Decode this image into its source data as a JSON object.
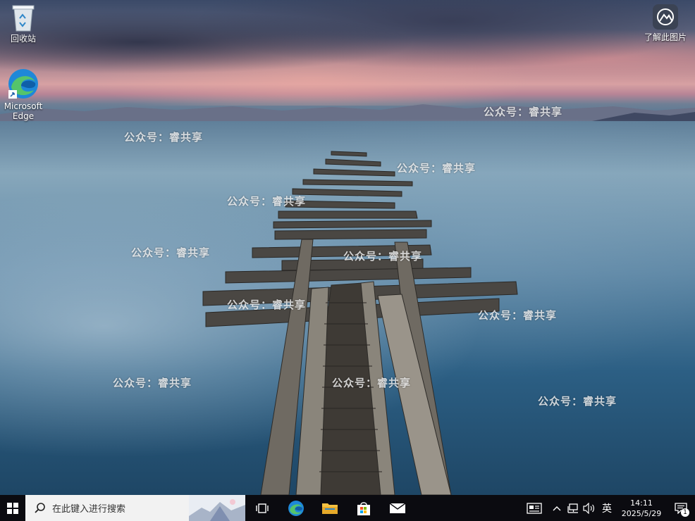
{
  "desktop": {
    "icons": [
      {
        "label": "回收站",
        "icon": "recycle-bin-icon"
      },
      {
        "label": "Microsoft\nEdge",
        "icon": "edge-icon"
      },
      {
        "label": "了解此图片",
        "icon": "learn-about-picture-icon"
      }
    ],
    "watermark_text": "公众号：睿共享"
  },
  "taskbar": {
    "start_icon": "windows-logo-icon",
    "search_placeholder": "在此键入进行搜索",
    "pinned": [
      {
        "name": "task-view",
        "icon": "task-view-icon"
      },
      {
        "name": "edge",
        "icon": "edge-icon"
      },
      {
        "name": "file-explorer",
        "icon": "folder-icon"
      },
      {
        "name": "microsoft-store",
        "icon": "store-icon"
      },
      {
        "name": "mail",
        "icon": "mail-icon"
      }
    ],
    "tray": {
      "ime_label": "英",
      "time": "14:11",
      "date": "2025/5/29",
      "notification_count": "1"
    }
  },
  "colors": {
    "taskbar_bg": "#0b0b10",
    "search_bg": "#f2f2f2",
    "edge_blue": "#1e88d8",
    "edge_green": "#55c46b",
    "folder_yellow": "#f5c242"
  }
}
